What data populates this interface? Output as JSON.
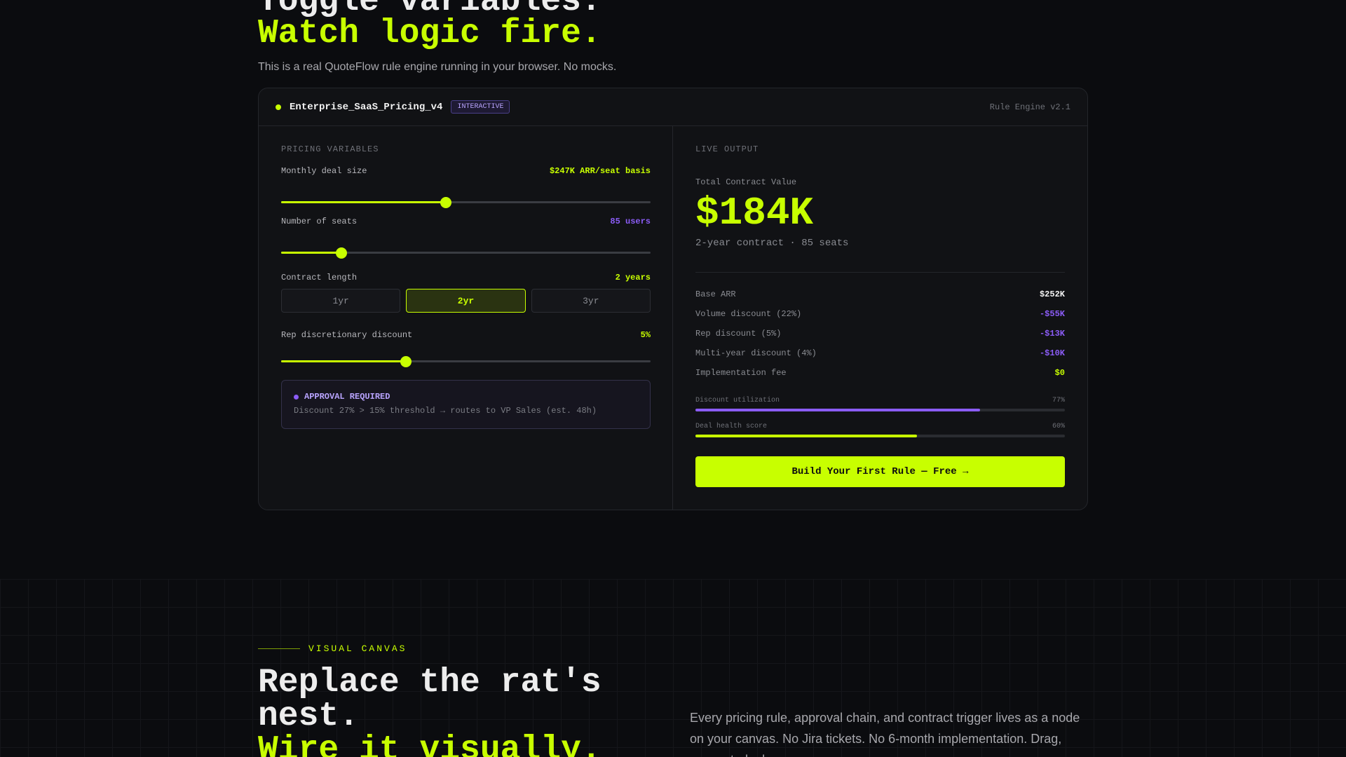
{
  "hero": {
    "line1": "Toggle variables.",
    "line2": "Watch logic fire.",
    "subtitle": "This is a real QuoteFlow rule engine running in your browser. No mocks."
  },
  "card": {
    "title": "Enterprise_SaaS_Pricing_v4",
    "badge": "INTERACTIVE",
    "engine": "Rule Engine v2.1"
  },
  "variables": {
    "section_label": "PRICING VARIABLES",
    "deal_size": {
      "label": "Monthly deal size",
      "value": "$247K ARR/seat basis",
      "level": 0.446
    },
    "seats": {
      "label": "Number of seats",
      "value": "85 users",
      "level": 0.163
    },
    "contract": {
      "label": "Contract length",
      "value": "2 years",
      "options": [
        "1yr",
        "2yr",
        "3yr"
      ],
      "selected": "2yr"
    },
    "rep_discount": {
      "label": "Rep discretionary discount",
      "value": "5%",
      "level": 0.338
    }
  },
  "approval": {
    "title": "APPROVAL REQUIRED",
    "text": "Discount 27% > 15% threshold → routes to VP Sales (est. 48h)"
  },
  "output": {
    "section_label": "LIVE OUTPUT",
    "tcv_label": "Total Contract Value",
    "tcv_value": "$184K",
    "tcv_sub": "2-year contract · 85 seats",
    "line_items": [
      {
        "label": "Base ARR",
        "value": "$252K"
      },
      {
        "label": "Volume discount (22%)",
        "value": "-$55K"
      },
      {
        "label": "Rep discount (5%)",
        "value": "-$13K"
      },
      {
        "label": "Multi-year discount (4%)",
        "value": "-$10K"
      },
      {
        "label": "Implementation fee",
        "value": "$0"
      }
    ],
    "meters": [
      {
        "label": "Discount utilization",
        "value": "77%",
        "level": 0.77,
        "color": "#8b5cf6"
      },
      {
        "label": "Deal health score",
        "value": "60%",
        "level": 0.6,
        "color": "#c8ff00"
      }
    ],
    "cta": "Build Your First Rule — Free →"
  },
  "canvas_section": {
    "eyebrow": "VISUAL CANVAS",
    "heading_line1": "Replace the rat's nest.",
    "heading_line2": "Wire it visually.",
    "paragraph": "Every pricing rule, approval chain, and contract trigger lives as a node on your canvas. No Jira tickets. No 6-month implementation. Drag, connect, deploy."
  },
  "colors": {
    "accent": "#c8ff00",
    "purple": "#8b5cf6",
    "background": "#0b0c0f"
  }
}
